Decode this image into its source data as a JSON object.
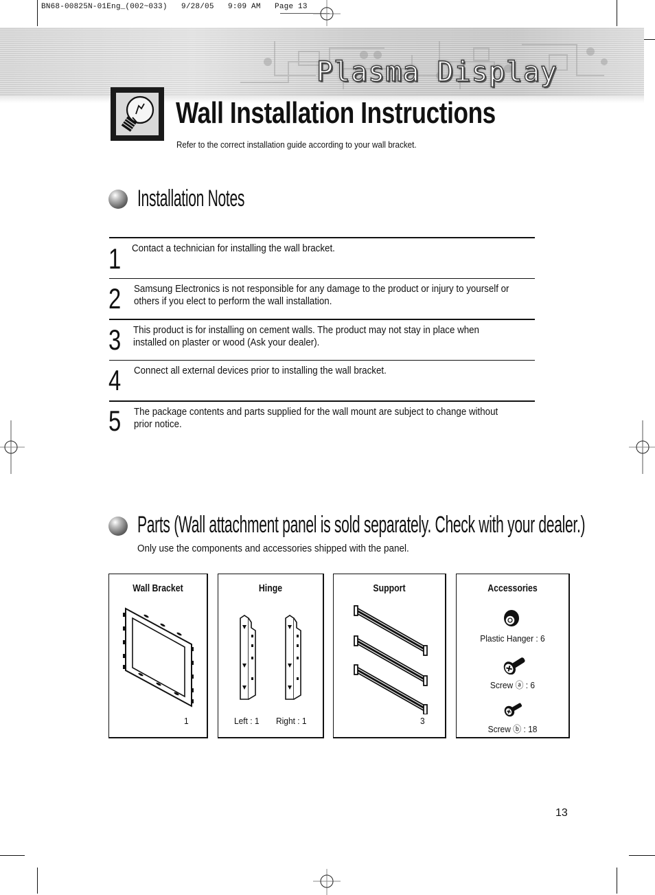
{
  "print_slug": "BN68-00825N-01Eng_(002~033)   9/28/05   9:09 AM   Page 13",
  "banner": {
    "product_title": "Plasma Display"
  },
  "header": {
    "icon": "lightbulb-tip-icon",
    "title": "Wall Installation Instructions",
    "subtitle": "Refer to the correct installation guide according to your wall bracket."
  },
  "installation_notes": {
    "heading": "Installation Notes",
    "bullet_icon": "sphere-bullet-icon",
    "items": [
      {
        "number": "1",
        "text": "Contact a technician for installing the wall bracket."
      },
      {
        "number": "2",
        "text": "Samsung Electronics is not responsible for any damage to the product or injury to yourself or others if you elect to perform the wall installation."
      },
      {
        "number": "3",
        "text": "This product is for installing on cement walls. The product may not stay in place when installed on plaster or wood (Ask your dealer)."
      },
      {
        "number": "4",
        "text": "Connect all external devices prior to installing the wall bracket."
      },
      {
        "number": "5",
        "text": "The package contents and parts supplied for the wall mount are subject to change without prior notice."
      }
    ]
  },
  "parts": {
    "heading": "Parts (Wall attachment panel is sold separately. Check with your dealer.)",
    "intro": "Only use the components and accessories shipped with the panel.",
    "cards": [
      {
        "title": "Wall Bracket",
        "icon": "wall-bracket-icon",
        "quantity": "1"
      },
      {
        "title": "Hinge",
        "icon": "hinge-icon",
        "left_label": "Left : 1",
        "right_label": "Right : 1"
      },
      {
        "title": "Support",
        "icon": "support-bar-icon",
        "quantity": "3"
      },
      {
        "title": "Accessories",
        "items": [
          {
            "icon": "plastic-hanger-icon",
            "label": "Plastic Hanger : 6"
          },
          {
            "icon": "screw-a-icon",
            "label": "Screw ⓐ : 6"
          },
          {
            "icon": "screw-b-icon",
            "label": "Screw ⓑ : 18"
          }
        ]
      }
    ]
  },
  "page_number": "13"
}
